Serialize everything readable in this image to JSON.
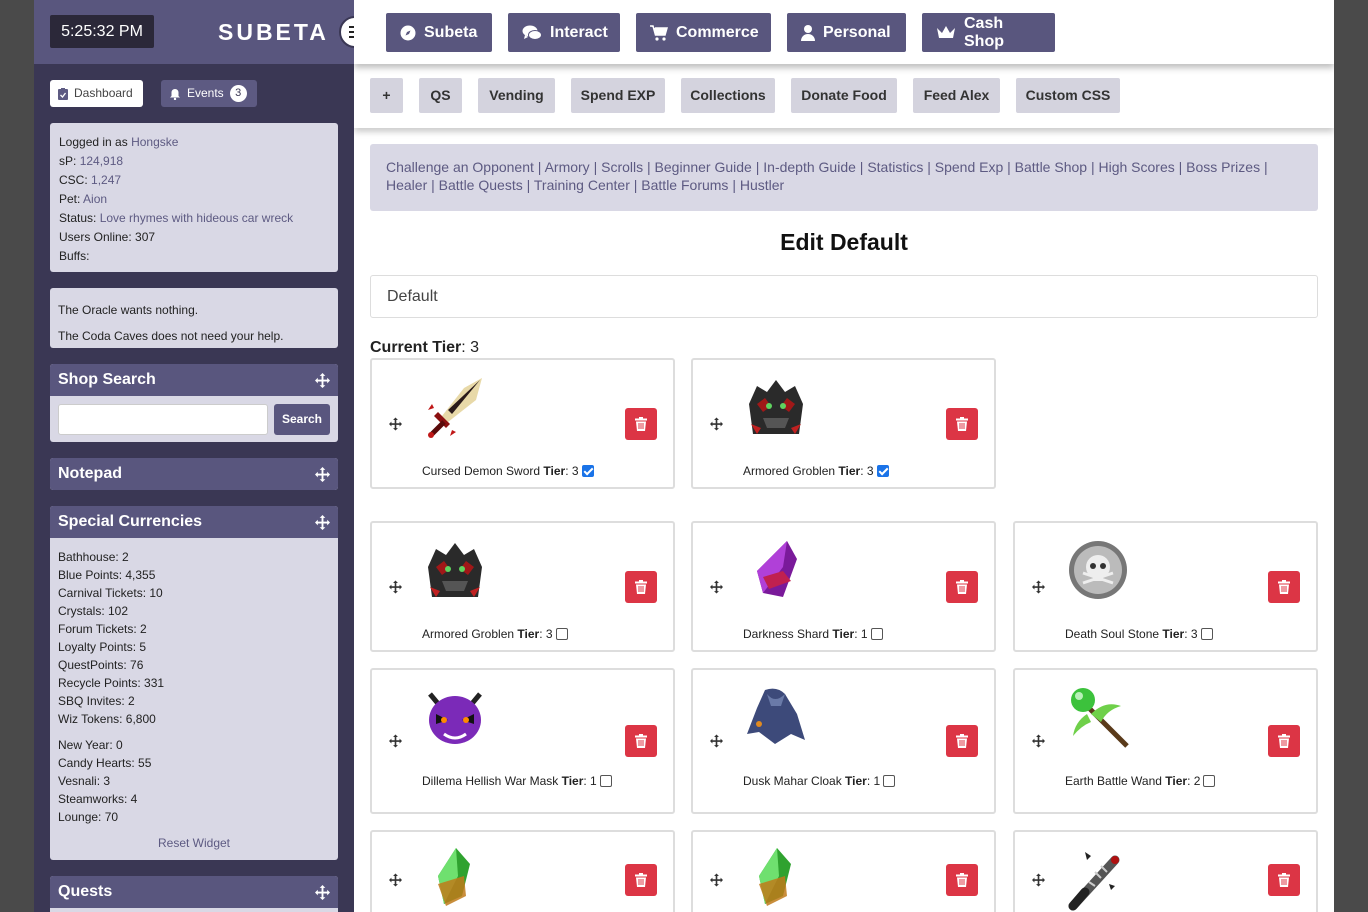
{
  "clock": "5:25:32 PM",
  "logo": "SUBETA",
  "tabs": {
    "dashboard": "Dashboard",
    "events": "Events",
    "events_count": "3"
  },
  "user": {
    "logged_label": "Logged in as",
    "username": "Hongske",
    "sp_label": "sP:",
    "sp": "124,918",
    "csc_label": "CSC:",
    "csc": "1,247",
    "pet_label": "Pet:",
    "pet": "Aion",
    "status_label": "Status:",
    "status": "Love rhymes with hideous car wreck",
    "online": "Users Online: 307",
    "buffs": "Buffs:"
  },
  "oracle": {
    "line1": "The Oracle wants nothing.",
    "line2": "The Coda Caves does not need your help."
  },
  "shop_search": {
    "title": "Shop Search",
    "button": "Search",
    "value": ""
  },
  "notepad": {
    "title": "Notepad"
  },
  "currencies": {
    "title": "Special Currencies",
    "group1": [
      "Bathhouse: 2",
      "Blue Points: 4,355",
      "Carnival Tickets: 10",
      "Crystals: 102",
      "Forum Tickets: 2",
      "Loyalty Points: 5",
      "QuestPoints: 76",
      "Recycle Points: 331",
      "SBQ Invites: 2",
      "Wiz Tokens: 6,800"
    ],
    "group2": [
      "New Year: 0",
      "Candy Hearts: 55",
      "Vesnali: 3",
      "Steamworks: 4",
      "Lounge: 70"
    ],
    "reset": "Reset Widget"
  },
  "quests": {
    "title": "Quests"
  },
  "nav": {
    "subeta": "Subeta",
    "interact": "Interact",
    "commerce": "Commerce",
    "personal": "Personal",
    "cash_shop": "Cash Shop"
  },
  "subnav": [
    "+",
    "QS",
    "Vending",
    "Spend EXP",
    "Collections",
    "Donate Food",
    "Feed Alex",
    "Custom CSS"
  ],
  "battle_links": [
    "Challenge an Opponent",
    "Armory",
    "Scrolls",
    "Beginner Guide",
    "In-depth Guide",
    "Statistics",
    "Spend Exp",
    "Battle Shop",
    "High Scores",
    "Boss Prizes",
    "Healer",
    "Battle Quests",
    "Training Center",
    "Battle Forums",
    "Hustler"
  ],
  "page_title": "Edit Default",
  "set_name": "Default",
  "current_tier_label": "Current Tier",
  "current_tier": ": 3",
  "tier_word": "Tier",
  "items": [
    {
      "name": "Cursed Demon Sword",
      "tier": ": 3",
      "checked": true,
      "icon": "sword-icon"
    },
    {
      "name": "Armored Groblen",
      "tier": ": 3",
      "checked": true,
      "icon": "armor-icon"
    },
    {
      "name": "Armored Groblen",
      "tier": ": 3",
      "checked": false,
      "icon": "armor-icon"
    },
    {
      "name": "Darkness Shard",
      "tier": ": 1",
      "checked": false,
      "icon": "shard-icon"
    },
    {
      "name": "Death Soul Stone",
      "tier": ": 3",
      "checked": false,
      "icon": "skull-stone-icon"
    },
    {
      "name": "Dillema Hellish War Mask",
      "tier": ": 1",
      "checked": false,
      "icon": "mask-icon"
    },
    {
      "name": "Dusk Mahar Cloak",
      "tier": ": 1",
      "checked": false,
      "icon": "cloak-icon"
    },
    {
      "name": "Earth Battle Wand",
      "tier": ": 2",
      "checked": false,
      "icon": "wand-icon"
    },
    {
      "name": "",
      "tier": "",
      "checked": false,
      "icon": "green-shard-icon"
    },
    {
      "name": "",
      "tier": "",
      "checked": false,
      "icon": "green-shard-icon"
    },
    {
      "name": "",
      "tier": "",
      "checked": false,
      "icon": "bat-icon"
    }
  ],
  "colors": {
    "primary": "#59567e",
    "sidebar": "#3a3754",
    "panel": "#d9d8e5",
    "delete": "#dc3545"
  }
}
